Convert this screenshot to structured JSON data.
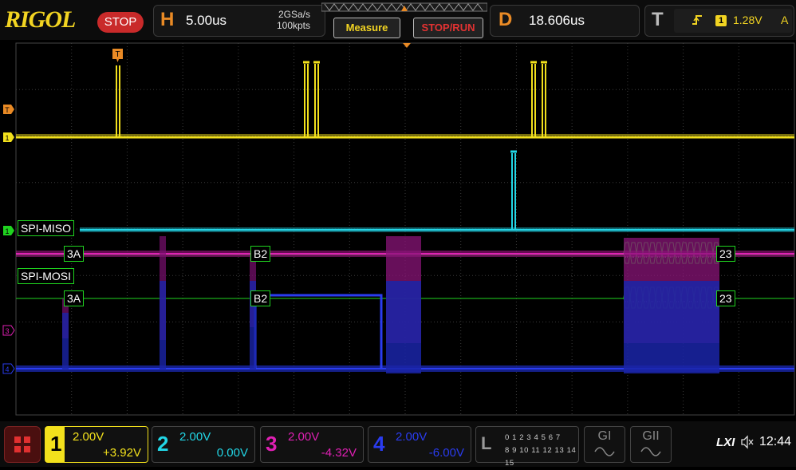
{
  "header": {
    "brand": "RIGOL",
    "run_state": "STOP",
    "horizontal": {
      "letter": "H",
      "timebase": "5.00us",
      "sample_rate": "2GSa/s",
      "memory_depth": "100kpts"
    },
    "measure_label": "Measure",
    "stop_run_label": "STOP/RUN",
    "delay": {
      "letter": "D",
      "value": "18.606us"
    },
    "trigger": {
      "letter": "T",
      "edge_icon": "rising-edge-icon",
      "source": "1",
      "level": "1.28V",
      "mode": "A"
    }
  },
  "markers": {
    "trigger_position": "T",
    "left_trigger_level": "T",
    "left_ch1": "1",
    "left_ch3": "3",
    "left_ch4": "4"
  },
  "decode": {
    "miso": {
      "label": "SPI-MISO",
      "marker": "1",
      "values": [
        "3A",
        "B2",
        "23"
      ]
    },
    "mosi": {
      "label": "SPI-MOSI",
      "values": [
        "3A",
        "B2",
        "23"
      ]
    }
  },
  "channels": [
    {
      "number": "1",
      "scale": "2.00V",
      "offset": "+3.92V",
      "color": "#f2e01c"
    },
    {
      "number": "2",
      "scale": "2.00V",
      "offset": "0.00V",
      "color": "#22d6e6"
    },
    {
      "number": "3",
      "scale": "2.00V",
      "offset": "-4.32V",
      "color": "#e020b4"
    },
    {
      "number": "4",
      "scale": "2.00V",
      "offset": "-6.00V",
      "color": "#2a3cf0"
    }
  ],
  "logic": {
    "letter": "L",
    "bits_row1": "0 1 2 3  4 5 6 7",
    "bits_row2": "8 9 10 11  12 13 14 15"
  },
  "generators": [
    {
      "label": "GI"
    },
    {
      "label": "GII"
    }
  ],
  "status": {
    "lxi": "LXI",
    "time": "12:44"
  },
  "colors": {
    "accent": "#f2d422",
    "stop": "#c92a2a",
    "orange": "#e98a25",
    "decode": "#1fd31f"
  }
}
